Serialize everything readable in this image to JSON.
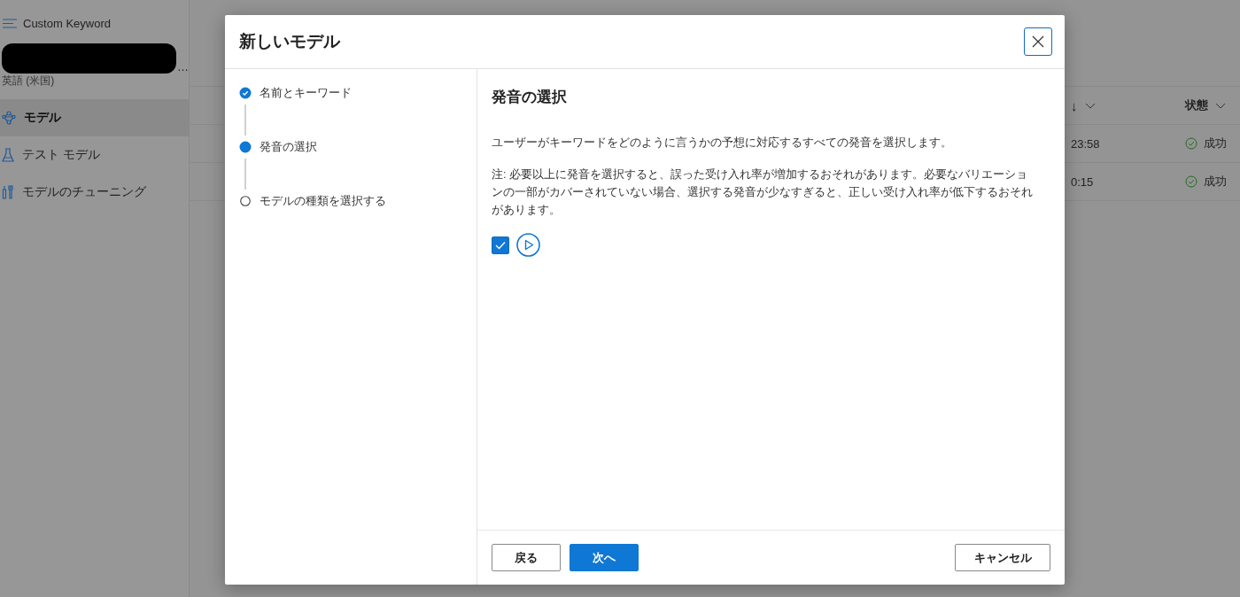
{
  "sidebar": {
    "app_title": "Custom Keyword",
    "project_suffix": "…",
    "language": "英語 (米国)",
    "items": [
      {
        "label": "モデル",
        "selected": true,
        "kind": "model"
      },
      {
        "label": "テスト モデル",
        "selected": false,
        "kind": "test"
      },
      {
        "label": "モデルのチューニング",
        "selected": false,
        "kind": "tuning"
      }
    ]
  },
  "table": {
    "columns": [
      {
        "label": "↓"
      },
      {
        "label": "状態"
      }
    ],
    "rows": [
      {
        "time": "23:58",
        "status": "成功"
      },
      {
        "time": "0:15",
        "status": "成功"
      }
    ]
  },
  "dialog": {
    "title": "新しいモデル",
    "steps": [
      {
        "label": "名前とキーワード",
        "kind": "done"
      },
      {
        "label": "発音の選択",
        "kind": "current"
      },
      {
        "label": "モデルの種類を選択する",
        "kind": "pending"
      }
    ],
    "heading": "発音の選択",
    "description": "ユーザーがキーワードをどのように言うかの予想に対応するすべての発音を選択します。",
    "note": "注: 必要以上に発音を選択すると、誤った受け入れ率が増加するおそれがあります。必要なバリエーションの一部がカバーされていない場合、選択する発音が少なすぎると、正しい受け入れ率が低下するおそれがあります。",
    "pronunciations": [
      {
        "checked": true
      }
    ],
    "buttons": [
      {
        "label": "戻る",
        "kind": "default"
      },
      {
        "label": "次へ",
        "kind": "primary"
      },
      {
        "label": "キャンセル",
        "kind": "default"
      }
    ]
  }
}
